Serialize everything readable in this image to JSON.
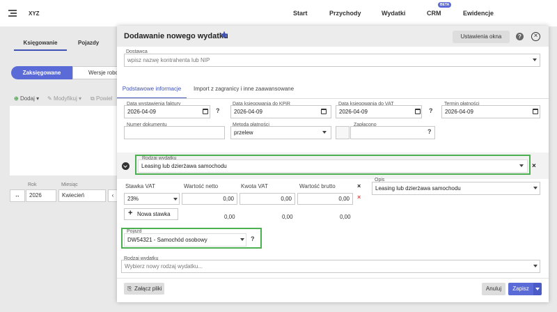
{
  "app": {
    "brand": "XYZ",
    "nav": [
      "Start",
      "Przychody",
      "Wydatki",
      "CRM",
      "Ewidencje"
    ],
    "beta_badge": "BETA"
  },
  "background": {
    "tabs": [
      "Księgowanie",
      "Pojazdy"
    ],
    "status_tabs": [
      "Zaksięgowane",
      "Wersje robo"
    ],
    "toolbar": [
      "Dodaj",
      "Modyfikuj",
      "Powiel"
    ],
    "year_label": "Rok",
    "year_value": "2026",
    "month_label": "Miesiąc",
    "month_value": "Kwiecień"
  },
  "modal": {
    "title": "Dodawanie nowego wydatku",
    "settings_button": "Ustawienia okna",
    "supplier": {
      "label": "Dostawca",
      "placeholder": "wpisz nazwę kontrahenta lub NIP"
    },
    "tabs": [
      "Podstawowe informacje",
      "Import z zagranicy i inne zaawansowane"
    ],
    "dates": [
      {
        "label": "Data wystawienia faktury",
        "value": "2026-04-09"
      },
      {
        "label": "Data księgowania do KPiR",
        "value": "2026-04-09"
      },
      {
        "label": "Data księgowania do VAT",
        "value": "2026-04-09"
      },
      {
        "label": "Termin płatności",
        "value": "2026-04-09"
      }
    ],
    "doc_number": {
      "label": "Numer dokumentu",
      "value": ""
    },
    "payment_method": {
      "label": "Metoda płatności",
      "value": "przelew"
    },
    "paid": {
      "label": "Zapłacono"
    },
    "expense_type": {
      "label": "Rodzaj wydatku",
      "value": "Leasing lub dzierżawa samochodu"
    },
    "vat_table": {
      "headers": [
        "Stawka VAT",
        "Wartość netto",
        "Kwota VAT",
        "Wartość brutto"
      ],
      "row": {
        "rate": "23%",
        "net": "0,00",
        "vat": "0,00",
        "gross": "0,00"
      },
      "add_rate": "Nowa stawka",
      "totals": {
        "net": "0,00",
        "vat": "0,00",
        "gross": "0,00"
      }
    },
    "description": {
      "label": "Opis",
      "value": "Leasing lub dzierżawa samochodu"
    },
    "vehicle": {
      "label": "Pojazd",
      "value": "DW54321 - Samochód osobowy"
    },
    "expense_type_2": {
      "label": "Rodzaj wydatku",
      "placeholder": "Wybierz nowy rodzaj wydatku..."
    },
    "footer": {
      "attach": "Załącz pliki",
      "cancel": "Anuluj",
      "save": "Zapisz"
    }
  },
  "colors": {
    "accent": "#5a6bd8",
    "highlight": "#4caf50"
  }
}
